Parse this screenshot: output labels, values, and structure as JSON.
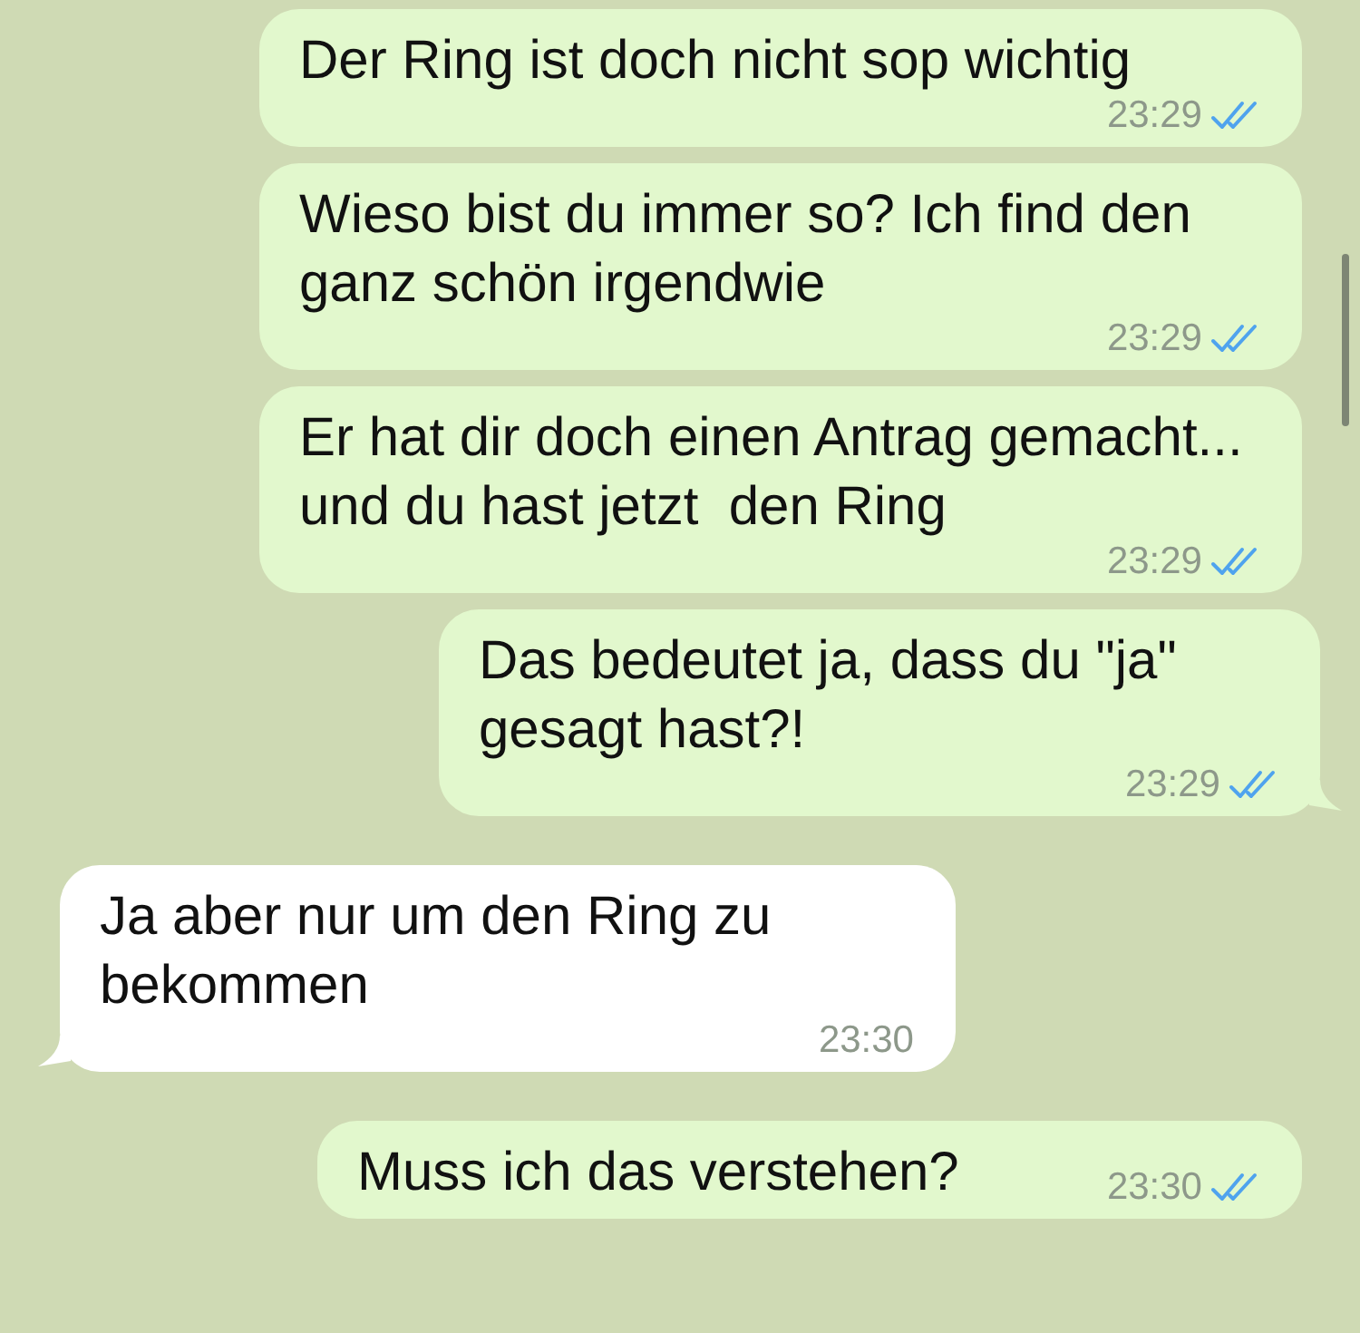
{
  "messages": [
    {
      "kind": "outgoing",
      "text": "Der Ring ist doch nicht sop wichtig",
      "time": "23:29",
      "read": true,
      "tail": false
    },
    {
      "kind": "outgoing",
      "text": "Wieso bist du immer so? Ich find den ganz schön irgendwie",
      "time": "23:29",
      "read": true,
      "tail": false
    },
    {
      "kind": "outgoing",
      "text": "Er hat dir doch einen Antrag gemacht... und du hast jetzt  den Ring",
      "time": "23:29",
      "read": true,
      "tail": false
    },
    {
      "kind": "outgoing",
      "text": "Das bedeutet ja, dass du \"ja\" gesagt hast?!",
      "time": "23:29",
      "read": true,
      "tail": true
    },
    {
      "kind": "incoming",
      "text": "Ja aber nur um den Ring zu bekommen",
      "time": "23:30",
      "tail": true
    },
    {
      "kind": "outgoing",
      "text": "Muss ich das verstehen?",
      "time": "23:30",
      "read": true,
      "tail": false
    }
  ]
}
